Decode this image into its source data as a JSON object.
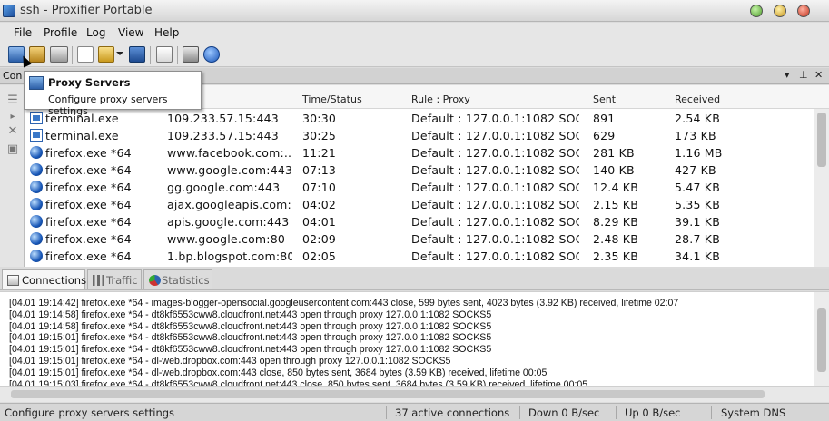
{
  "window": {
    "title": "ssh - Proxifier Portable"
  },
  "menu": [
    "File",
    "Profile",
    "Log",
    "View",
    "Help"
  ],
  "toolbar_icons": [
    "proxy-servers-icon",
    "proxification-rules-icon",
    "name-resolution-icon",
    "new-profile-icon",
    "open-profile-icon",
    "dropdown-arrow-icon",
    "save-profile-icon",
    "check-profile-icon",
    "print-icon",
    "help-icon"
  ],
  "panel": {
    "title": "Con",
    "pin_glyph": "▾",
    "float_glyph": "⊥",
    "close_glyph": "✕"
  },
  "tooltip": {
    "title": "Proxy Servers",
    "text": "Configure proxy servers settings"
  },
  "table": {
    "columns": {
      "time_status": "Time/Status",
      "rule_proxy": "Rule : Proxy",
      "sent": "Sent",
      "received": "Received"
    },
    "rows": [
      {
        "icon": "terminal",
        "app": "terminal.exe",
        "target": "109.233.57.15:443",
        "time": "30:30",
        "rule": "Default : 127.0.0.1:1082 SOC...",
        "sent": "891",
        "received": "2.54 KB"
      },
      {
        "icon": "terminal",
        "app": "terminal.exe",
        "target": "109.233.57.15:443",
        "time": "30:25",
        "rule": "Default : 127.0.0.1:1082 SOC...",
        "sent": "629",
        "received": "173 KB"
      },
      {
        "icon": "globe",
        "app": "firefox.exe *64",
        "target": "www.facebook.com:...",
        "time": "11:21",
        "rule": "Default : 127.0.0.1:1082 SOC...",
        "sent": "281 KB",
        "received": "1.16 MB"
      },
      {
        "icon": "globe",
        "app": "firefox.exe *64",
        "target": "www.google.com:443",
        "time": "07:13",
        "rule": "Default : 127.0.0.1:1082 SOC...",
        "sent": "140 KB",
        "received": "427 KB"
      },
      {
        "icon": "globe",
        "app": "firefox.exe *64",
        "target": "gg.google.com:443",
        "time": "07:10",
        "rule": "Default : 127.0.0.1:1082 SOC...",
        "sent": "12.4 KB",
        "received": "5.47 KB"
      },
      {
        "icon": "globe",
        "app": "firefox.exe *64",
        "target": "ajax.googleapis.com:...",
        "time": "04:02",
        "rule": "Default : 127.0.0.1:1082 SOC...",
        "sent": "2.15 KB",
        "received": "5.35 KB"
      },
      {
        "icon": "globe",
        "app": "firefox.exe *64",
        "target": "apis.google.com:443",
        "time": "04:01",
        "rule": "Default : 127.0.0.1:1082 SOC...",
        "sent": "8.29 KB",
        "received": "39.1 KB"
      },
      {
        "icon": "globe",
        "app": "firefox.exe *64",
        "target": "www.google.com:80",
        "time": "02:09",
        "rule": "Default : 127.0.0.1:1082 SOC...",
        "sent": "2.48 KB",
        "received": "28.7 KB"
      },
      {
        "icon": "globe",
        "app": "firefox.exe *64",
        "target": "1.bp.blogspot.com:80",
        "time": "02:05",
        "rule": "Default : 127.0.0.1:1082 SOC...",
        "sent": "2.35 KB",
        "received": "34.1 KB"
      }
    ]
  },
  "tabs": [
    "Connections",
    "Traffic",
    "Statistics"
  ],
  "log": [
    "[04.01 19:14:42] firefox.exe *64 - images-blogger-opensocial.googleusercontent.com:443 close, 599 bytes sent, 4023 bytes (3.92 KB) received, lifetime 02:07",
    "[04.01 19:14:58] firefox.exe *64 - dt8kf6553cww8.cloudfront.net:443 open through proxy 127.0.0.1:1082 SOCKS5",
    "[04.01 19:14:58] firefox.exe *64 - dt8kf6553cww8.cloudfront.net:443 open through proxy 127.0.0.1:1082 SOCKS5",
    "[04.01 19:15:01] firefox.exe *64 - dt8kf6553cww8.cloudfront.net:443 open through proxy 127.0.0.1:1082 SOCKS5",
    "[04.01 19:15:01] firefox.exe *64 - dt8kf6553cww8.cloudfront.net:443 open through proxy 127.0.0.1:1082 SOCKS5",
    "[04.01 19:15:01] firefox.exe *64 - dl-web.dropbox.com:443 open through proxy 127.0.0.1:1082 SOCKS5",
    "[04.01 19:15:01] firefox.exe *64 - dl-web.dropbox.com:443 close, 850 bytes sent, 3684 bytes (3.59 KB) received, lifetime 00:05",
    "[04.01 19:15:03] firefox.exe *64 - dt8kf6553cww8.cloudfront.net:443 close, 850 bytes sent, 3684 bytes (3.59 KB) received, lifetime 00:05"
  ],
  "status": {
    "hint": "Configure proxy servers settings",
    "connections": "37 active connections",
    "down": "Down 0 B/sec",
    "up": "Up 0 B/sec",
    "dns": "System DNS"
  }
}
